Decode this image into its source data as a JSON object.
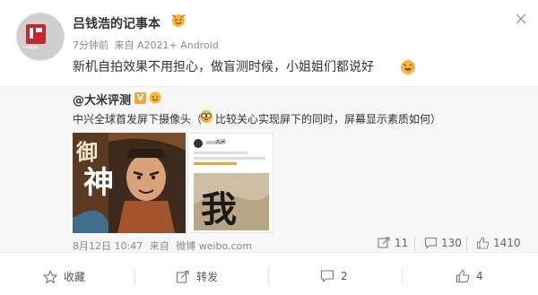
{
  "post": {
    "user_name": "吕钱浩的记事本",
    "time_ago": "7分钟前",
    "source": "来自 A2021+ Android",
    "text": "新机自拍效果不用担心，做盲测时候，小姐姐们都说好",
    "avatar_watermark": "feedback"
  },
  "repost": {
    "name": "@大米评测",
    "verified_mark": "V",
    "text_part1": "中兴全球首发屏下摄像头（",
    "text_part2": "比较关心实现屏下的同时，屏幕显示素质如何）",
    "date": "8月12日 10:47",
    "via": "来自",
    "site": "微博 weibo.com",
    "stats": {
      "repost_count": "11",
      "comment_count": "130",
      "like_count": "1410"
    },
    "image1_chars": [
      "御",
      "神"
    ],
    "image2_header": "大米",
    "image2_chars": [
      "我"
    ]
  },
  "actions": {
    "favorite": "收藏",
    "forward": "转发",
    "comment": "2",
    "like": "4"
  },
  "colors": {
    "accent_orange": "#f2a73b",
    "text_primary": "#333333",
    "text_meta": "#8a8a8a",
    "repost_bg": "#f7f7f7"
  }
}
